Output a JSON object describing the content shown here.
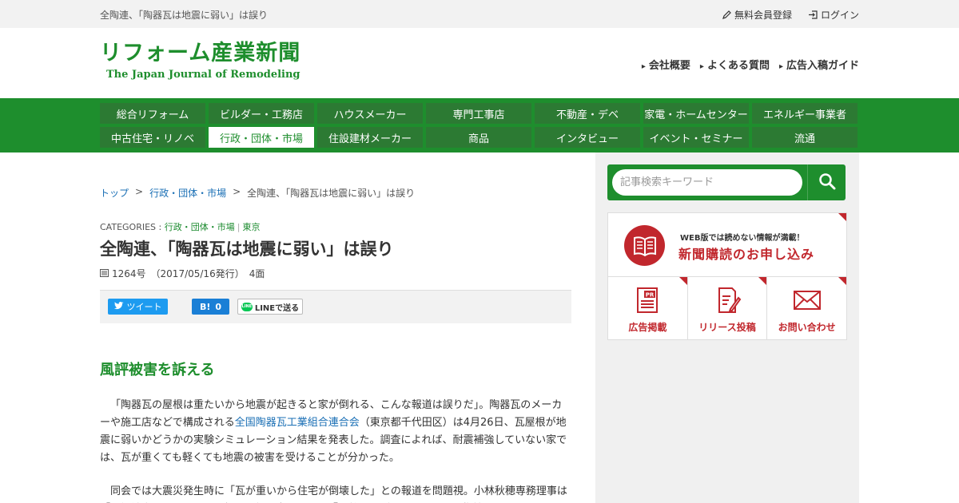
{
  "topbar": {
    "page_title": "全陶連、「陶器瓦は地震に弱い」は誤り",
    "register": "無料会員登録",
    "login": "ログイン"
  },
  "logo": {
    "jp": "リフォーム産業新聞",
    "en": "The Japan Journal of Remodeling"
  },
  "header_links": [
    "会社概要",
    "よくある質問",
    "広告入稿ガイド"
  ],
  "nav": {
    "row1": [
      "総合リフォーム",
      "ビルダー・工務店",
      "ハウスメーカー",
      "専門工事店",
      "不動産・デベ",
      "家電・ホームセンター",
      "エネルギー事業者"
    ],
    "row2": [
      "中古住宅・リノベ",
      "行政・団体・市場",
      "住設建材メーカー",
      "商品",
      "インタビュー",
      "イベント・セミナー",
      "流通"
    ],
    "active": "行政・団体・市場"
  },
  "breadcrumb": {
    "home": "トップ",
    "sep": ">",
    "category": "行政・団体・市場",
    "current": "全陶連、「陶器瓦は地震に弱い」は誤り"
  },
  "article": {
    "categories_label": "CATEGORIES :",
    "categories": [
      "行政・団体・市場",
      "東京"
    ],
    "title": "全陶連、「陶器瓦は地震に弱い」は誤り",
    "issue": "1264号　（2017/05/16発行）　4面",
    "share": {
      "tweet": "ツイート",
      "hatena_b": "B!",
      "hatena_count": "0",
      "line": "LINEで送る",
      "line_badge": "LINE"
    },
    "subheading": "風評被害を訴える",
    "para1_a": "「陶器瓦の屋根は重たいから地震が起きると家が倒れる、こんな報道は誤りだ」。陶器瓦のメーカーや施工店などで構成される",
    "para1_link": "全国陶器瓦工業組合連合会",
    "para1_b": "（東京都千代田区）は4月26日、瓦屋根が地震に弱いかどうかの実験シミュレーション結果を発表した。調査によれば、耐震補強していない家では、瓦が重くても軽くても地震の被害を受けることが分かった。",
    "para2": "同会では大震災発生時に「瓦が重いから住宅が倒壊した」との報道を問題視。小林秋穂専務理事は「風評被害により、瓦から軽量屋根に変えるなど『瓦離れ』が起きている」と指摘す"
  },
  "sidebar": {
    "search_placeholder": "記事検索キーワード",
    "promo_small": "WEB版では読めない情報が満載！",
    "promo_big": "新聞購読のお申し込み",
    "cells": [
      "広告掲載",
      "リリース投稿",
      "お問い合わせ"
    ],
    "pr_badge": "PR"
  },
  "colors": {
    "brand_green": "#1e8e2d",
    "accent_red": "#c1272d",
    "link_blue": "#1a6fb5"
  }
}
